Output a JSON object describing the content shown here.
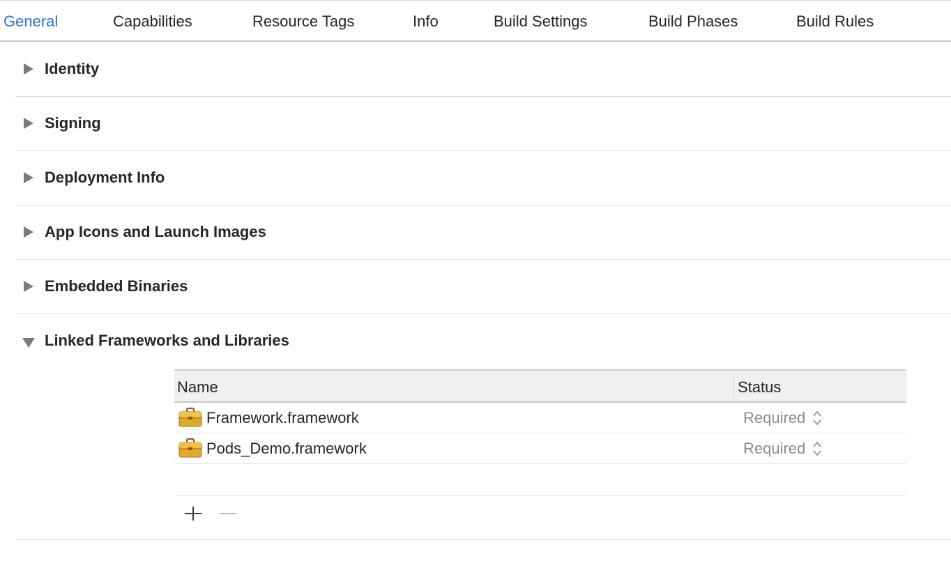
{
  "tabs": [
    {
      "label": "General",
      "active": true
    },
    {
      "label": "Capabilities"
    },
    {
      "label": "Resource Tags"
    },
    {
      "label": "Info"
    },
    {
      "label": "Build Settings"
    },
    {
      "label": "Build Phases"
    },
    {
      "label": "Build Rules"
    }
  ],
  "sections": [
    {
      "label": "Identity",
      "expanded": false
    },
    {
      "label": "Signing",
      "expanded": false
    },
    {
      "label": "Deployment Info",
      "expanded": false
    },
    {
      "label": "App Icons and Launch Images",
      "expanded": false
    },
    {
      "label": "Embedded Binaries",
      "expanded": false
    },
    {
      "label": "Linked Frameworks and Libraries",
      "expanded": true
    }
  ],
  "frameworks_table": {
    "columns": {
      "name": "Name",
      "status": "Status"
    },
    "rows": [
      {
        "name": "Framework.framework",
        "status": "Required",
        "icon": "briefcase-icon"
      },
      {
        "name": "Pods_Demo.framework",
        "status": "Required",
        "icon": "briefcase-icon"
      }
    ]
  },
  "toolbar": {
    "add_icon": "plus-icon",
    "remove_icon": "minus-icon"
  },
  "colors": {
    "accent": "#2a73d9",
    "status_text": "#8c8c8c",
    "briefcase": "#e2a92b"
  }
}
